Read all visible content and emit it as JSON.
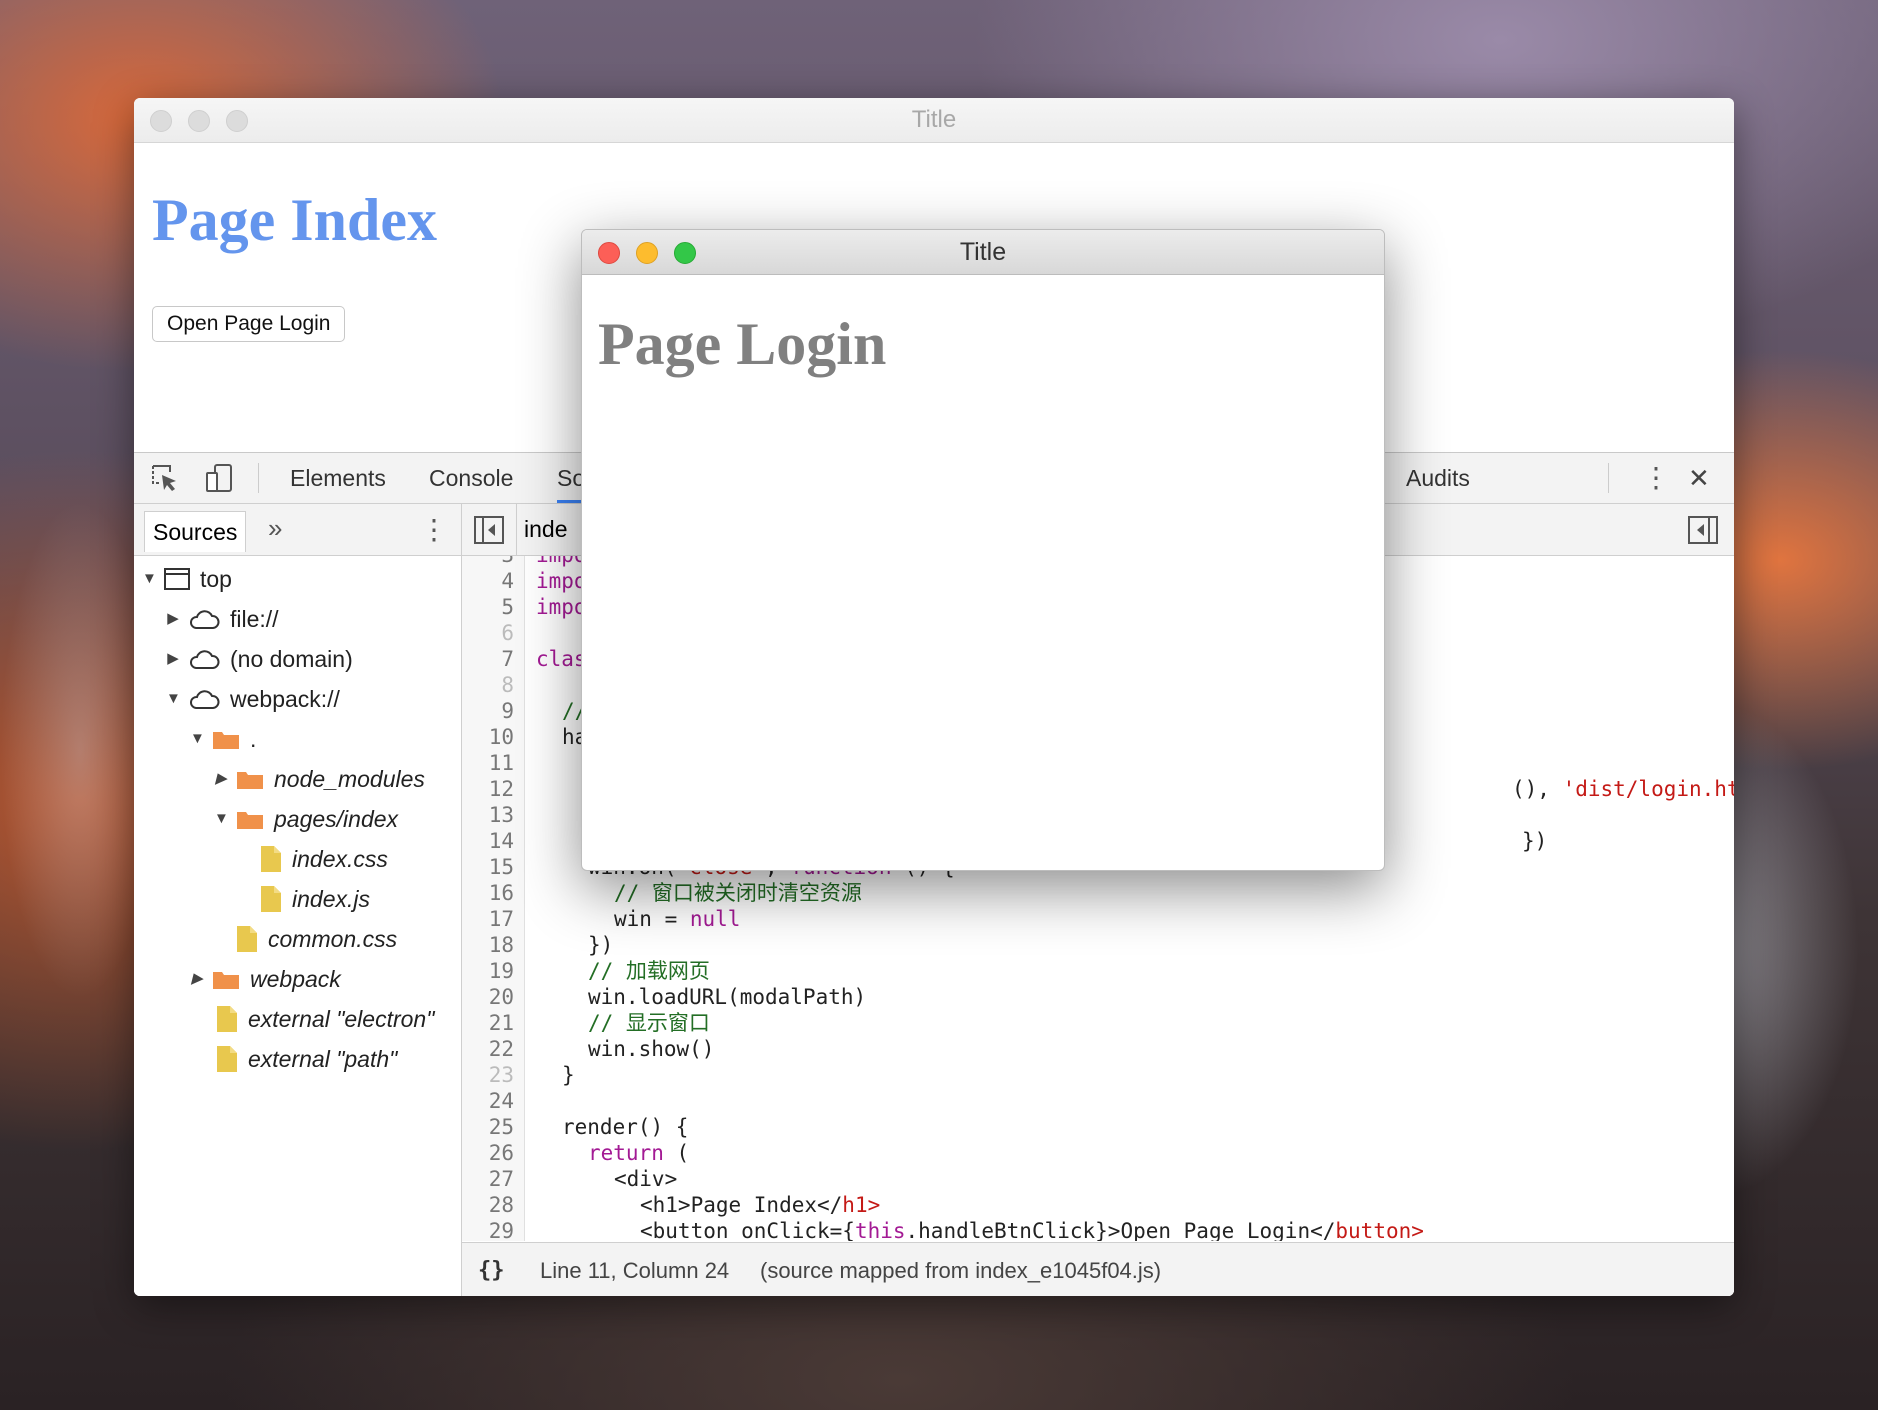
{
  "main_window": {
    "title": "Title",
    "heading": "Page Index",
    "open_button_label": "Open Page Login"
  },
  "devtools": {
    "tabs": [
      "Elements",
      "Console",
      "So",
      "Audits"
    ],
    "left_pane_tab": "Sources",
    "more_tabs_glyph": "»",
    "menu_glyph": "⋮",
    "close_glyph": "✕",
    "editor_tab_label": "inde",
    "tree": [
      {
        "label": "top",
        "icon": "frame-icon",
        "expanded": true
      },
      {
        "label": "file://",
        "icon": "cloud-icon",
        "expanded": false
      },
      {
        "label": "(no domain)",
        "icon": "cloud-icon",
        "expanded": false
      },
      {
        "label": "webpack://",
        "icon": "cloud-icon",
        "expanded": true
      },
      {
        "label": ".",
        "icon": "folder-icon",
        "expanded": true
      },
      {
        "label": "node_modules",
        "icon": "folder-icon",
        "expanded": false
      },
      {
        "label": "pages/index",
        "icon": "folder-icon",
        "expanded": true
      },
      {
        "label": "index.css",
        "icon": "file-icon"
      },
      {
        "label": "index.js",
        "icon": "file-icon"
      },
      {
        "label": "common.css",
        "icon": "file-icon"
      },
      {
        "label": "webpack",
        "icon": "folder-icon",
        "expanded": false
      },
      {
        "label": "external \"electron\"",
        "icon": "file-icon"
      },
      {
        "label": "external \"path\"",
        "icon": "file-icon"
      }
    ],
    "line_numbers": [
      "3",
      "4",
      "5",
      "6",
      "7",
      "8",
      "9",
      "10",
      "11",
      "12",
      "13",
      "14",
      "15",
      "16",
      "17",
      "18",
      "19",
      "20",
      "21",
      "22",
      "23",
      "24",
      "25",
      "26",
      "27",
      "28",
      "29"
    ],
    "code": {
      "l3": "impo",
      "l4": "impo",
      "l5": "impo",
      "l7": "clas",
      "l9": "//",
      "l10": "ha",
      "l12a": "(), ",
      "l12b": "'dist/login.html'",
      "l12c": ");",
      "l14": "})",
      "l15a": "win.on(",
      "l15b": "'close'",
      "l15c": ", ",
      "l15d": "function",
      "l15e": " () {",
      "l16": "// 窗口被关闭时清空资源",
      "l17a": "win = ",
      "l17b": "null",
      "l18": "})",
      "l19": "// 加载网页",
      "l20": "win.loadURL(modalPath)",
      "l21": "// 显示窗口",
      "l22": "win.show()",
      "l23": "}",
      "l25": "render() {",
      "l26a": "return",
      "l26b": " (",
      "l27": "<div>",
      "l28a": "<h1>Page Index</",
      "l28b": "h1",
      "l28c": ">",
      "l29a": "<button onClick={",
      "l29b": "this",
      "l29c": ".handleBtnClick}>Open Page Login</",
      "l29d": "button",
      "l29e": ">"
    },
    "status": {
      "braces": "{}",
      "position": "Line 11, Column 24",
      "source_mapped": "(source mapped from index_e1045f04.js)"
    }
  },
  "modal_window": {
    "title": "Title",
    "heading": "Page Login"
  },
  "colors": {
    "index_heading": "#6495ed",
    "login_heading": "#808080",
    "keyword": "#a31a94",
    "string": "#c41a16",
    "comment": "#236e25",
    "active_tab_underline": "#3b82f6"
  }
}
